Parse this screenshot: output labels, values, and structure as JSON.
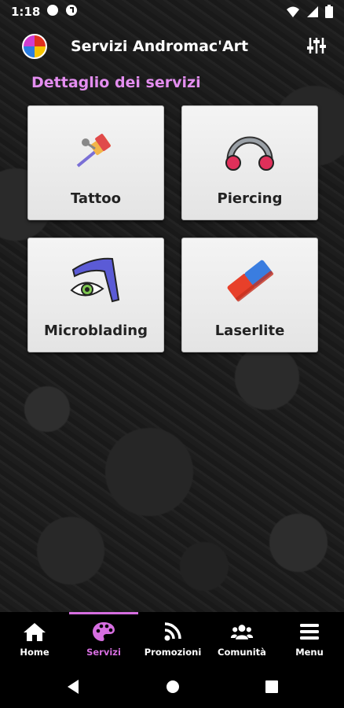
{
  "status_bar": {
    "time": "1:18"
  },
  "app_bar": {
    "title": "Servizi Andromac'Art"
  },
  "section": {
    "title": "Dettaglio dei servizi"
  },
  "services": [
    {
      "label": "Tattoo",
      "icon": "tattoo-machine-icon"
    },
    {
      "label": "Piercing",
      "icon": "piercing-ring-icon"
    },
    {
      "label": "Microblading",
      "icon": "eyebrow-eye-icon"
    },
    {
      "label": "Laserlite",
      "icon": "eraser-icon"
    }
  ],
  "bottom_nav": {
    "items": [
      {
        "label": "Home",
        "icon": "home-icon"
      },
      {
        "label": "Servizi",
        "icon": "palette-icon",
        "active": true
      },
      {
        "label": "Promozioni",
        "icon": "rss-feed-icon"
      },
      {
        "label": "Comunità",
        "icon": "users-icon"
      },
      {
        "label": "Menu",
        "icon": "hamburger-menu-icon"
      }
    ]
  },
  "colors": {
    "accent": "#d66ee0",
    "section_title": "#e48ef0",
    "card_bg": "#ededed"
  }
}
